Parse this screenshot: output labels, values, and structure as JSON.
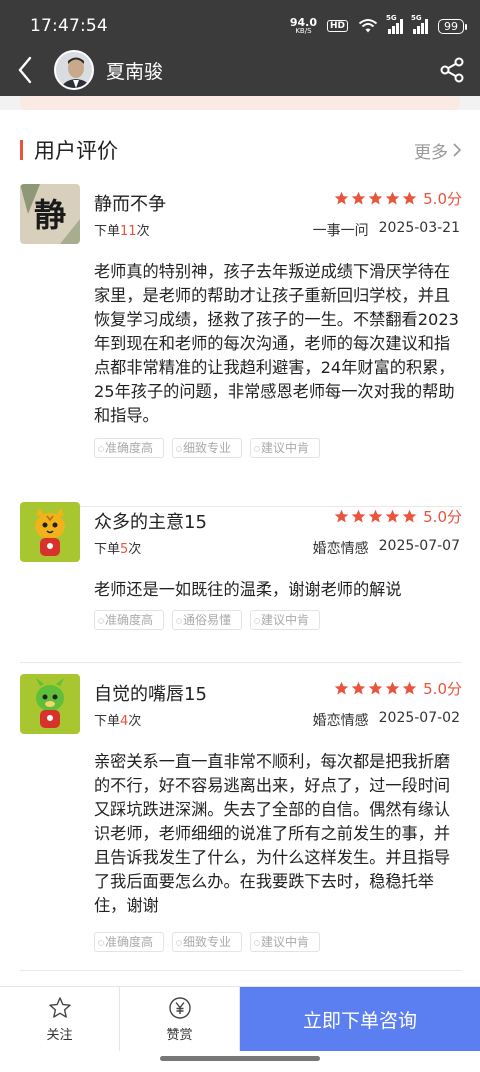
{
  "status_bar": {
    "time": "17:47:54",
    "net_speed": "94.0",
    "net_unit": "KB/S",
    "hd": "HD",
    "signal1": "5G",
    "signal2": "5G",
    "battery": "99"
  },
  "header": {
    "back_icon": "chevron-left-icon",
    "name": "夏南骏",
    "share_icon": "share-icon"
  },
  "section": {
    "title": "用户评价",
    "more": "更多"
  },
  "reviews": [
    {
      "name": "静而不争",
      "orders_prefix": "下单",
      "orders_count": "11",
      "orders_suffix": "次",
      "score": "5.0分",
      "category": "一事一问",
      "date": "2025-03-21",
      "text": "老师真的特别神，孩子去年叛逆成绩下滑厌学待在家里，是老师的帮助才让孩子重新回归学校，并且恢复学习成绩，拯救了孩子的一生。不禁翻看2023年到现在和老师的每次沟通，老师的每次建议和指点都非常精准的让我趋利避害，24年财富的积累，25年孩子的问题，非常感恩老师每一次对我的帮助和指导。",
      "tags": [
        "准确度高",
        "细致专业",
        "建议中肯"
      ],
      "avatar_char": "静"
    },
    {
      "name": "众多的主意15",
      "orders_prefix": "下单",
      "orders_count": "5",
      "orders_suffix": "次",
      "score": "5.0分",
      "category": "婚恋情感",
      "date": "2025-07-07",
      "text": "老师还是一如既往的温柔，谢谢老师的解说",
      "tags": [
        "准确度高",
        "通俗易懂",
        "建议中肯"
      ]
    },
    {
      "name": "自觉的嘴唇15",
      "orders_prefix": "下单",
      "orders_count": "4",
      "orders_suffix": "次",
      "score": "5.0分",
      "category": "婚恋情感",
      "date": "2025-07-02",
      "text": "亲密关系一直一直非常不顺利，每次都是把我折磨的不行，好不容易逃离出来，好点了，过一段时间又踩坑跌进深渊。失去了全部的自信。偶然有缘认识老师，老师细细的说准了所有之前发生的事，并且告诉我发生了什么，为什么这样发生。并且指导了我后面要怎么办。在我要跌下去时，稳稳托举住，谢谢",
      "tags": [
        "准确度高",
        "细致专业",
        "建议中肯"
      ]
    }
  ],
  "bottom_bar": {
    "follow": "关注",
    "reward": "赞赏",
    "cta": "立即下单咨询",
    "follow_icon": "star-outline-icon",
    "reward_icon": "yuan-coin-icon"
  },
  "colors": {
    "accent": "#e8553c",
    "cta": "#5b7ff0",
    "topbar": "#3b3b3b"
  }
}
